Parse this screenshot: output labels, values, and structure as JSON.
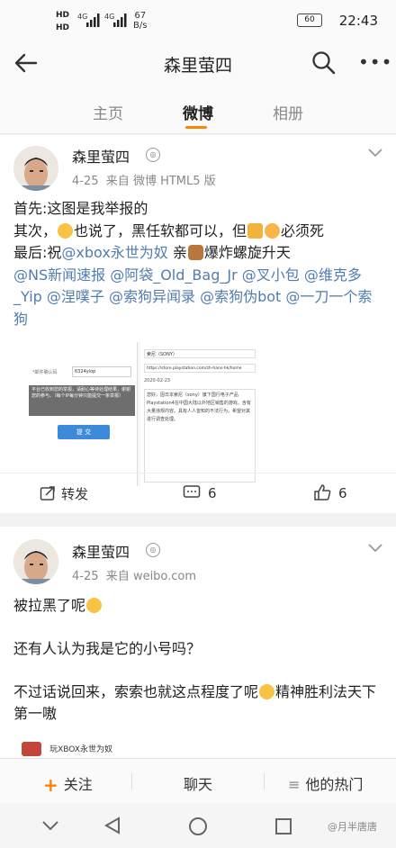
{
  "status_bar": {
    "left_top": "HD",
    "left_bottom": "HD",
    "net1": "4G",
    "net2": "4G",
    "speed_value": "67",
    "speed_unit": "B/s",
    "battery": "60",
    "time": "22:43"
  },
  "header": {
    "title": "森里萤四"
  },
  "tabs": [
    {
      "label": "主页"
    },
    {
      "label": "微博"
    },
    {
      "label": "相册"
    }
  ],
  "posts": [
    {
      "author": "森里萤四",
      "date": "4-25",
      "source_prefix": "来自",
      "source": "微博 HTML5 版",
      "line1": "首先:这图是我举报的",
      "line2_a": "其次，",
      "line2_b": "也说了，黑任软都可以，但",
      "line2_c": "必须死",
      "line3_a": "最后:祝",
      "line3_link": "@xbox永世为奴",
      "line3_b": " 亲",
      "line3_c": "爆炸螺旋升天",
      "mentions": "@NS新闻速报 @阿袋_Old_Bag_Jr @叉小包 @维克多_Yip @涅噗子 @索狗异闻录 @索狗伪bot @一刀一个索狗",
      "image": {
        "left_label": "*邮件确认码",
        "left_value": "6324yiop",
        "notice": "平台已收到您的举报，请耐心等待处理结果，谢谢您的参与。（每个IP每分钟只能提交一条举报）",
        "submit": "提 交",
        "right_name": "索尼（SONY）",
        "right_url": "https://store.playstation.com/zh-hans-hk/home",
        "right_date": "2020-02-23",
        "right_body": "您好，因日本索尼（sony）旗下国行电子产品Playstation4在中国大陆以外地区销售的游戏，含有大量违规内容。具有人人皆知的不法行为，希望对其进行调查处理。"
      },
      "repost_label": "转发",
      "comment_count": "6",
      "like_count": "6"
    },
    {
      "author": "森里萤四",
      "date": "4-25",
      "source_prefix": "来自",
      "source": "weibo.com",
      "line1": "被拉黑了呢",
      "line2": "还有人认为我是它的小号吗？",
      "line3_a": "不过话说回来，索索也就这点程度了呢",
      "line3_b": "精神胜利法天下第一嗷",
      "quoted_user": "玩XBOX永世为奴"
    }
  ],
  "bottom_bar": {
    "follow": "关注",
    "chat": "聊天",
    "hot": "他的热门"
  },
  "watermark": "@月半唐唐"
}
